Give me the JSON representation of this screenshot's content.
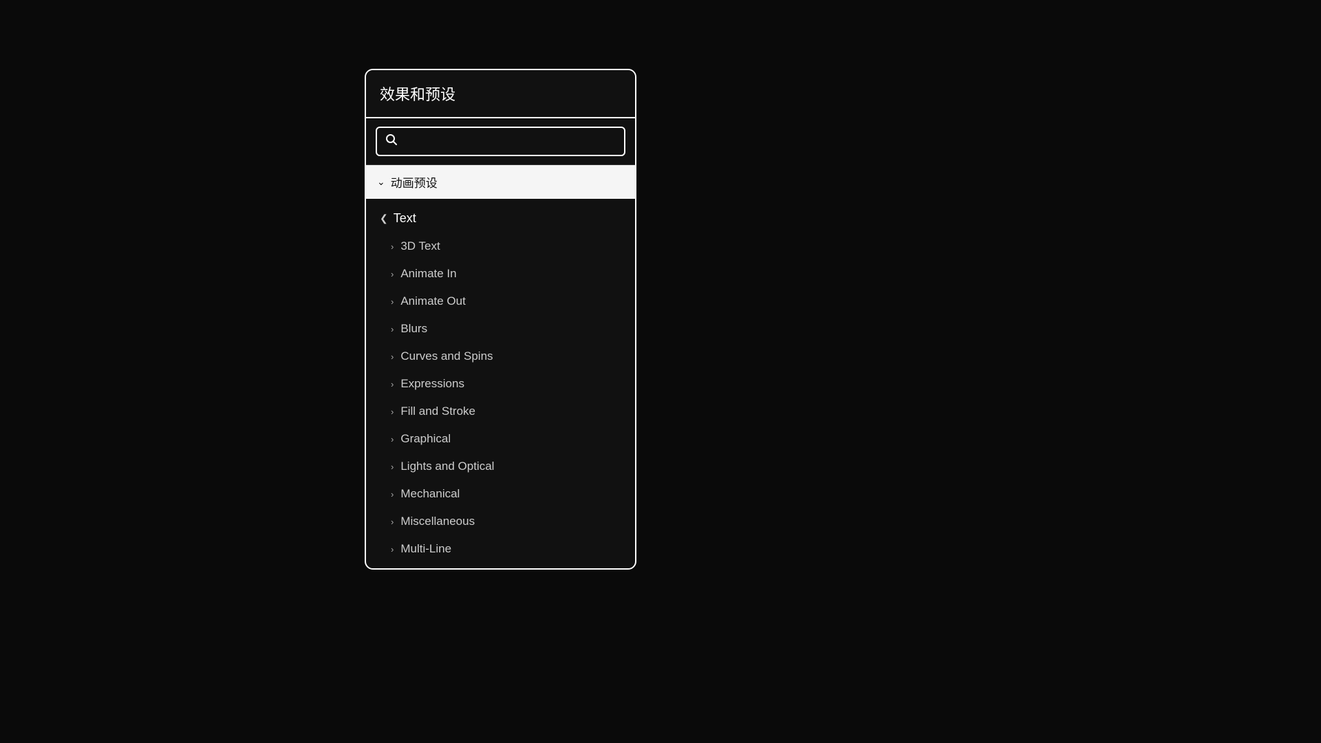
{
  "panel": {
    "title": "效果和预设",
    "search": {
      "placeholder": "",
      "value": ""
    },
    "category": {
      "label": "动画预设",
      "subcategory": {
        "label": "Text",
        "items": [
          {
            "label": "3D Text"
          },
          {
            "label": "Animate In"
          },
          {
            "label": "Animate Out"
          },
          {
            "label": "Blurs"
          },
          {
            "label": "Curves and Spins"
          },
          {
            "label": "Expressions"
          },
          {
            "label": "Fill and Stroke"
          },
          {
            "label": "Graphical"
          },
          {
            "label": "Lights and Optical"
          },
          {
            "label": "Mechanical"
          },
          {
            "label": "Miscellaneous"
          },
          {
            "label": "Multi-Line"
          }
        ]
      }
    }
  },
  "icons": {
    "chevron_down": "∨",
    "chevron_right": "›",
    "search": "○"
  }
}
